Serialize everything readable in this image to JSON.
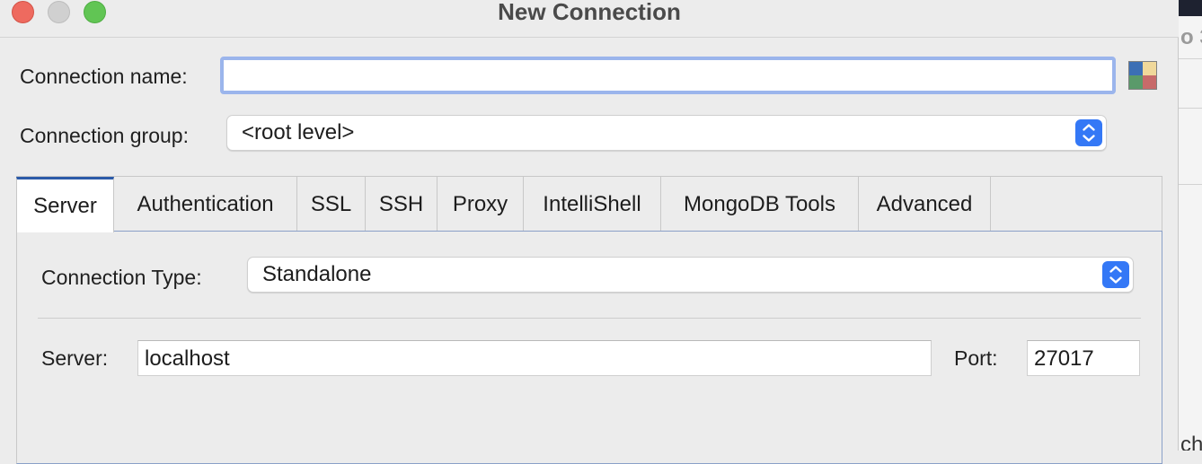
{
  "window": {
    "title": "New Connection"
  },
  "connection": {
    "name_label": "Connection name:",
    "name_value": "",
    "group_label": "Connection group:",
    "group_value": "<root level>"
  },
  "colors": {
    "accent": "#3478f6",
    "focus_ring": "#9bb5ec",
    "tab_active_border": "#2b5aa8",
    "color_picker": [
      "#3c6fb5",
      "#f0d89a",
      "#5a9a6a",
      "#c76a6a"
    ]
  },
  "tabs": [
    {
      "label": "Server",
      "active": true
    },
    {
      "label": "Authentication",
      "active": false
    },
    {
      "label": "SSL",
      "active": false
    },
    {
      "label": "SSH",
      "active": false
    },
    {
      "label": "Proxy",
      "active": false
    },
    {
      "label": "IntelliShell",
      "active": false
    },
    {
      "label": "MongoDB Tools",
      "active": false
    },
    {
      "label": "Advanced",
      "active": false
    }
  ],
  "server_tab": {
    "type_label": "Connection Type:",
    "type_value": "Standalone",
    "server_label": "Server:",
    "server_value": "localhost",
    "port_label": "Port:",
    "port_value": "27017"
  },
  "background_window": {
    "text_top": "o 3",
    "text_bottom": "ch"
  }
}
